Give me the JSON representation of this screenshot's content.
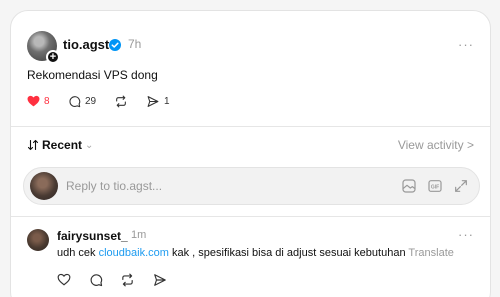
{
  "post": {
    "username": "tio.agst",
    "time": "7h",
    "more": "···",
    "text": "Rekomendasi VPS dong",
    "likes": "8",
    "replies": "29",
    "shares": "1"
  },
  "sort": {
    "label": "Recent",
    "view_activity": "View activity >"
  },
  "reply_box": {
    "placeholder": "Reply to tio.agst..."
  },
  "comment": {
    "username": "fairysunset_",
    "time": "1m",
    "more": "···",
    "text_before": "udh cek ",
    "link": "cloudbaik.com",
    "text_after": " kak , spesifikasi bisa di adjust sesuai kebutuhan",
    "translate": "Translate"
  },
  "colors": {
    "like_red": "#ff3040",
    "link_blue": "#1d9bf0",
    "verified_blue": "#0095f6"
  }
}
